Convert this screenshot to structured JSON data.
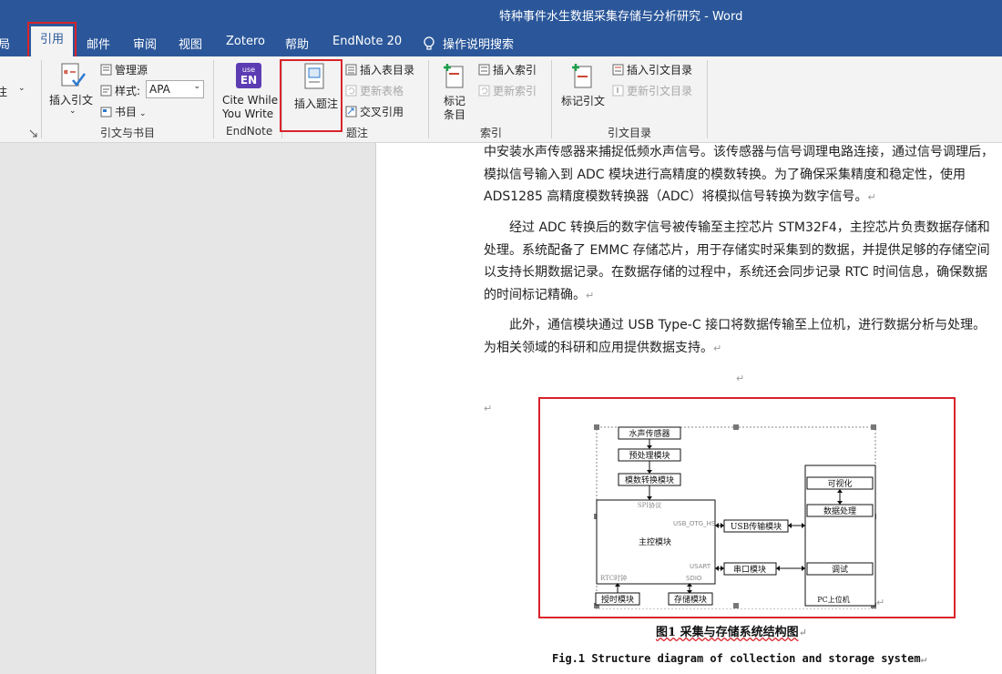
{
  "window": {
    "title": "特种事件水生数据采集存储与分析研究  -  Word"
  },
  "tabs": [
    {
      "label": "布局",
      "partial": "局"
    },
    {
      "label": "引用"
    },
    {
      "label": "邮件"
    },
    {
      "label": "审阅"
    },
    {
      "label": "视图"
    },
    {
      "label": "Zotero"
    },
    {
      "label": "帮助"
    },
    {
      "label": "EndNote 20"
    },
    {
      "label": "操作说明搜索"
    }
  ],
  "ribbon": {
    "footnotes_partial": "注",
    "citations": {
      "insert_citation": "插入引文",
      "manage_sources": "管理源",
      "style_label": "样式:",
      "style_value": "APA",
      "bibliography": "书目",
      "group_label": "引文与书目"
    },
    "endnote": {
      "cite_line1": "Cite While",
      "cite_line2": "You Write",
      "group_label": "EndNote"
    },
    "captions": {
      "insert_caption": "插入题注",
      "insert_table_of_figures": "插入表目录",
      "update_table": "更新表格",
      "cross_reference": "交叉引用",
      "group_label": "题注"
    },
    "index": {
      "mark_entry_l1": "标记",
      "mark_entry_l2": "条目",
      "insert_index": "插入索引",
      "update_index": "更新索引",
      "group_label": "索引"
    },
    "toa": {
      "mark_citation": "标记引文",
      "insert_toa": "插入引文目录",
      "update_toa": "更新引文目录",
      "group_label": "引文目录"
    }
  },
  "document": {
    "paragraphs": [
      "中安装水声传感器来捕捉低频水声信号。该传感器与信号调理电路连接，通过信号调理后，模拟信号输入到 ADC 模块进行高精度的模数转换。为了确保采集精度和稳定性，使用 ADS1285 高精度模数转换器（ADC）将模拟信号转换为数字信号。",
      "经过 ADC 转换后的数字信号被传输至主控芯片 STM32F4，主控芯片负责数据存储和处理。系统配备了 EMMC 存储芯片，用于存储实时采集到的数据，并提供足够的存储空间以支持长期数据记录。在数据存储的过程中，系统还会同步记录 RTC 时间信息，确保数据的时间标记精确。",
      "此外，通信模块通过 USB Type-C 接口将数据传输至上位机，进行数据分析与处理。为相关领域的科研和应用提供数据支持。"
    ],
    "diagram": {
      "sensor": "水声传感器",
      "preprocess": "预处理模块",
      "adc": "模数转换模块",
      "spi": "SPI协议",
      "main": "主控模块",
      "usb_otg": "USB_OTG_HS",
      "usart": "USART",
      "rtc_clock": "RTC时钟",
      "sdio": "SDIO",
      "usb_module": "USB传输模块",
      "uart_module": "串口模块",
      "timer": "授时模块",
      "storage": "存储模块",
      "visual": "可视化",
      "data_proc": "数据处理",
      "debug": "调试",
      "pc": "PC上位机"
    },
    "caption_cn": "图1  采集与存储系统结构图",
    "caption_en": "Fig.1  Structure diagram of collection and storage system"
  }
}
